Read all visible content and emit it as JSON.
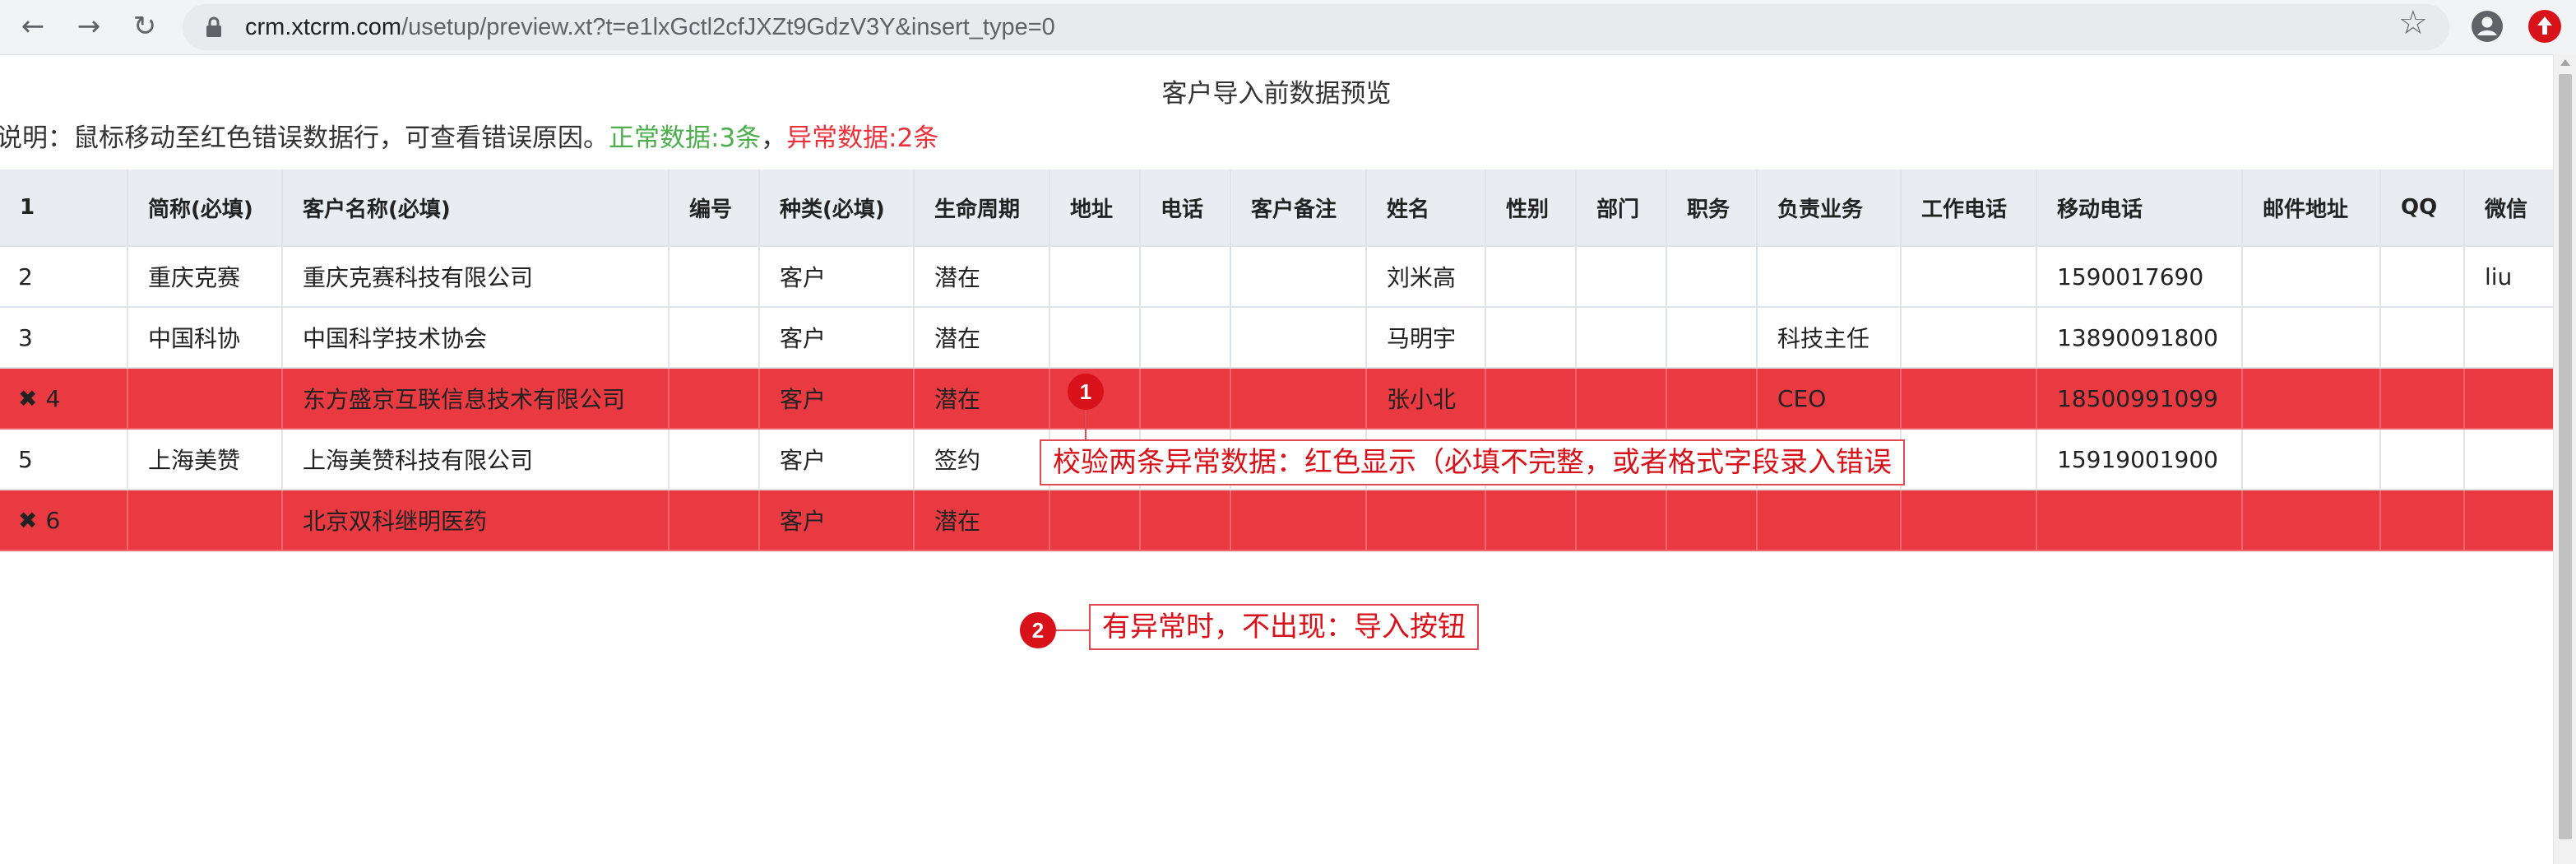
{
  "browser": {
    "url_host": "crm.xtcrm.com",
    "url_path": "/usetup/preview.xt?t=e1lxGctl2cfJXZt9GdzV3Y&insert_type=0",
    "back_icon": "arrow-left-icon",
    "forward_icon": "arrow-right-icon",
    "reload_icon": "reload-icon",
    "lock_icon": "lock-icon",
    "bookmark_icon": "star-icon",
    "account_icon": "account-icon",
    "extension_icon": "extension-icon"
  },
  "page": {
    "title": "客户导入前数据预览",
    "notice_prefix": "说明：鼠标移动至红色错误数据行，可查看错误原因。",
    "normal_count": "正常数据:3条",
    "separator": "，",
    "error_count": "异常数据:2条",
    "colors": {
      "normal": "#4cae4c",
      "error": "#e8323c",
      "error_row": "#e93a42"
    }
  },
  "table": {
    "headers": [
      "1",
      "简称(必填)",
      "客户名称(必填)",
      "编号",
      "种类(必填)",
      "生命周期",
      "地址",
      "电话",
      "客户备注",
      "姓名",
      "性别",
      "部门",
      "职务",
      "负责业务",
      "工作电话",
      "移动电话",
      "邮件地址",
      "QQ",
      "微信"
    ],
    "rows": [
      {
        "error": false,
        "mark": "",
        "cells": [
          "2",
          "重庆克赛",
          "重庆克赛科技有限公司",
          "",
          "客户",
          "潜在",
          "",
          "",
          "",
          "刘米高",
          "",
          "",
          "",
          "",
          "",
          "1590017690",
          "",
          "",
          "liu"
        ]
      },
      {
        "error": false,
        "mark": "",
        "cells": [
          "3",
          "中国科协",
          "中国科学技术协会",
          "",
          "客户",
          "潜在",
          "",
          "",
          "",
          "马明宇",
          "",
          "",
          "",
          "科技主任",
          "",
          "13890091800",
          "",
          "",
          ""
        ]
      },
      {
        "error": true,
        "mark": "✖",
        "cells": [
          "4",
          "",
          "东方盛京互联信息技术有限公司",
          "",
          "客户",
          "潜在",
          "",
          "",
          "",
          "张小北",
          "",
          "",
          "",
          "CEO",
          "",
          "18500991099",
          "",
          "",
          ""
        ]
      },
      {
        "error": false,
        "mark": "",
        "cells": [
          "5",
          "上海美赞",
          "上海美赞科技有限公司",
          "",
          "客户",
          "签约",
          "",
          "",
          "",
          "",
          "",
          "",
          "",
          "",
          "",
          "15919001900",
          "",
          "",
          ""
        ]
      },
      {
        "error": true,
        "mark": "✖",
        "cells": [
          "6",
          "",
          "北京双科继明医药",
          "",
          "客户",
          "潜在",
          "",
          "",
          "",
          "",
          "",
          "",
          "",
          "",
          "",
          "",
          "",
          "",
          ""
        ]
      }
    ]
  },
  "annotations": [
    {
      "number": "1",
      "text": "校验两条异常数据：红色显示（必填不完整，或者格式字段录入错误"
    },
    {
      "number": "2",
      "text": "有异常时，不出现：导入按钮"
    }
  ]
}
